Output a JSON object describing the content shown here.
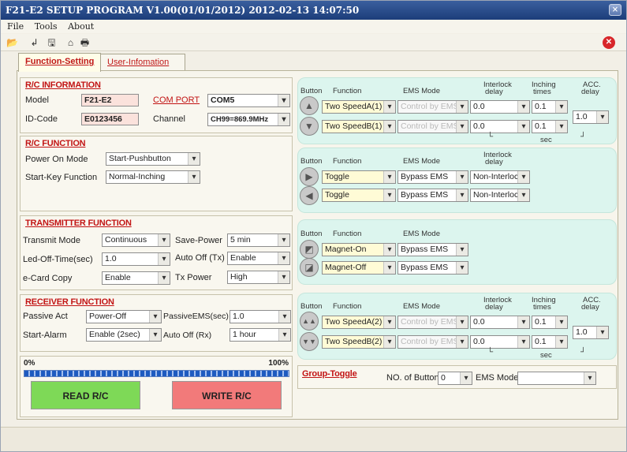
{
  "window": {
    "title": "F21-E2 SETUP PROGRAM V1.00(01/01/2012)  2012-02-13  14:07:50",
    "close": "×"
  },
  "menu": [
    "File",
    "Tools",
    "About"
  ],
  "tabs": [
    "Function-Setting",
    "User-Infomation"
  ],
  "rc_info": {
    "title": "R/C INFORMATION",
    "model_label": "Model",
    "model": "F21-E2",
    "id_label": "ID-Code",
    "id": "E0123456",
    "com_label": "COM PORT",
    "com": "COM5",
    "channel_label": "Channel",
    "channel": "CH99=869.9MHz"
  },
  "rc_function": {
    "title": "R/C  FUNCTION",
    "power_on_label": "Power On Mode",
    "power_on": "Start-Pushbutton",
    "start_key_label": "Start-Key Function",
    "start_key": "Normal-Inching"
  },
  "tx": {
    "title": "TRANSMITTER FUNCTION",
    "mode_label": "Transmit Mode",
    "mode": "Continuous",
    "save_label": "Save-Power",
    "save": "5  min",
    "led_label": "Led-Off-Time(sec)",
    "led": "1.0",
    "autooff_label": "Auto Off (Tx)",
    "autooff": "Enable",
    "ecard_label": "e-Card Copy",
    "ecard": "Enable",
    "txp_label": "Tx Power",
    "txp": "High"
  },
  "rx": {
    "title": "RECEIVER  FUNCTION",
    "passive_label": "Passive Act",
    "passive": "Power-Off",
    "pems_label": "PassiveEMS(sec)",
    "pems": "1.0",
    "alarm_label": "Start-Alarm",
    "alarm": "Enable (2sec)",
    "autooff_label": "Auto Off (Rx)",
    "autooff": "1 hour"
  },
  "hdr": {
    "button": "Button",
    "function": "Function",
    "ems": "EMS Mode",
    "interlock": "Interlock",
    "delay": "delay",
    "inching": "Inching",
    "times": "times",
    "acc": "ACC.",
    "accdelay": "delay",
    "sec": "sec"
  },
  "group1": {
    "rows": [
      {
        "func": "Two SpeedA(1)",
        "ems": "Control by EMS",
        "il": "0.0",
        "inch": "0.1"
      },
      {
        "func": "Two SpeedB(1)",
        "ems": "Control by EMS",
        "il": "0.0",
        "inch": "0.1"
      }
    ],
    "acc": "1.0"
  },
  "group2": {
    "rows": [
      {
        "func": "Toggle",
        "ems": "Bypass EMS",
        "il": "Non-Interlock"
      },
      {
        "func": "Toggle",
        "ems": "Bypass EMS",
        "il": "Non-Interlock"
      }
    ]
  },
  "group3": {
    "rows": [
      {
        "func": "Magnet-On",
        "ems": "Bypass EMS"
      },
      {
        "func": "Magnet-Off",
        "ems": "Bypass EMS"
      }
    ]
  },
  "group4": {
    "rows": [
      {
        "func": "Two SpeedA(2)",
        "ems": "Control by EMS",
        "il": "0.0",
        "inch": "0.1"
      },
      {
        "func": "Two SpeedB(2)",
        "ems": "Control by EMS",
        "il": "0.0",
        "inch": "0.1"
      }
    ],
    "acc": "1.0"
  },
  "progress": {
    "min": "0%",
    "max": "100%",
    "value": 1.0
  },
  "read_btn": "READ  R/C",
  "write_btn": "WRITE R/C",
  "group_toggle": {
    "title": "Group-Toggle",
    "nob_label": "NO. of Button",
    "nob": "0",
    "ems_label": "EMS Mode",
    "ems": ""
  },
  "colors": {
    "read": "#7ed957",
    "write": "#f27a7a",
    "panel": "#dcf5ee",
    "accent": "#c21414"
  }
}
